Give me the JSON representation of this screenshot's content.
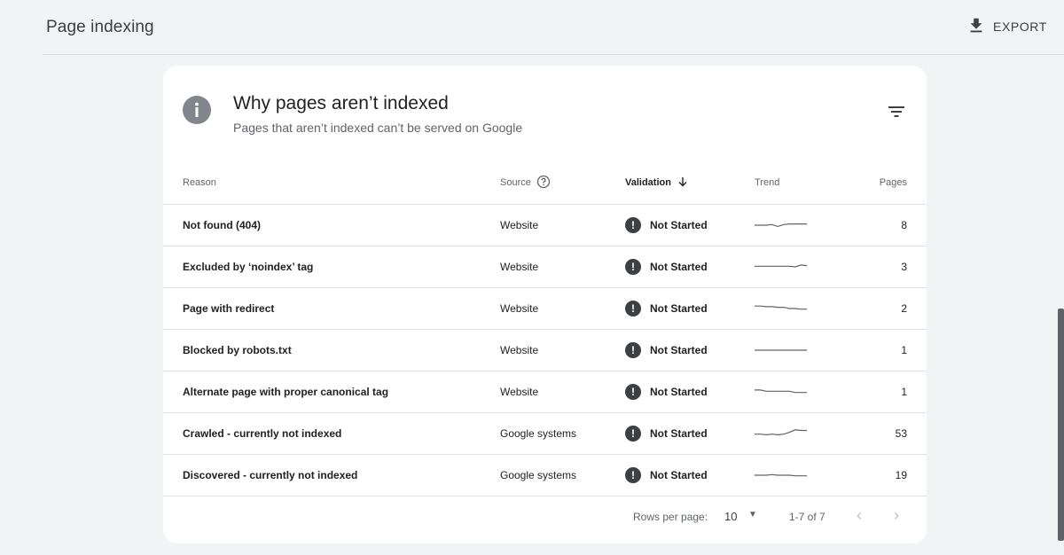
{
  "header": {
    "title": "Page indexing",
    "export_label": "EXPORT"
  },
  "card": {
    "title": "Why pages aren’t indexed",
    "subtitle": "Pages that aren’t indexed can’t be served on Google"
  },
  "table": {
    "columns": {
      "reason": "Reason",
      "source": "Source",
      "validation": "Validation",
      "trend": "Trend",
      "pages": "Pages"
    },
    "rows": [
      {
        "reason": "Not found (404)",
        "source": "Website",
        "validation": "Not Started",
        "pages": "8",
        "trend": [
          0.5,
          0.5,
          0.5,
          0.45,
          0.6,
          0.45,
          0.4,
          0.4,
          0.4,
          0.4
        ]
      },
      {
        "reason": "Excluded by ‘noindex’ tag",
        "source": "Website",
        "validation": "Not Started",
        "pages": "3",
        "trend": [
          0.45,
          0.45,
          0.45,
          0.45,
          0.45,
          0.45,
          0.45,
          0.5,
          0.35,
          0.4
        ]
      },
      {
        "reason": "Page with redirect",
        "source": "Website",
        "validation": "Not Started",
        "pages": "2",
        "trend": [
          0.3,
          0.3,
          0.35,
          0.35,
          0.4,
          0.4,
          0.5,
          0.5,
          0.55,
          0.55
        ]
      },
      {
        "reason": "Blocked by robots.txt",
        "source": "Website",
        "validation": "Not Started",
        "pages": "1",
        "trend": [
          0.5,
          0.5,
          0.5,
          0.5,
          0.5,
          0.5,
          0.5,
          0.5,
          0.5,
          0.5
        ]
      },
      {
        "reason": "Alternate page with proper canonical tag",
        "source": "Website",
        "validation": "Not Started",
        "pages": "1",
        "trend": [
          0.35,
          0.35,
          0.45,
          0.45,
          0.45,
          0.45,
          0.45,
          0.55,
          0.55,
          0.55
        ]
      },
      {
        "reason": "Crawled - currently not indexed",
        "source": "Google systems",
        "validation": "Not Started",
        "pages": "53",
        "trend": [
          0.55,
          0.55,
          0.6,
          0.55,
          0.6,
          0.55,
          0.4,
          0.2,
          0.25,
          0.25
        ]
      },
      {
        "reason": "Discovered - currently not indexed",
        "source": "Google systems",
        "validation": "Not Started",
        "pages": "19",
        "trend": [
          0.5,
          0.5,
          0.5,
          0.45,
          0.5,
          0.5,
          0.5,
          0.55,
          0.55,
          0.55
        ]
      }
    ]
  },
  "pagination": {
    "rows_per_page_label": "Rows per page:",
    "rows_per_page_value": "10",
    "range": "1-7 of 7"
  },
  "colors": {
    "background": "#f1f3f4",
    "card": "#ffffff",
    "status_icon": "#3c4043",
    "trend_line": "#5f6368"
  }
}
